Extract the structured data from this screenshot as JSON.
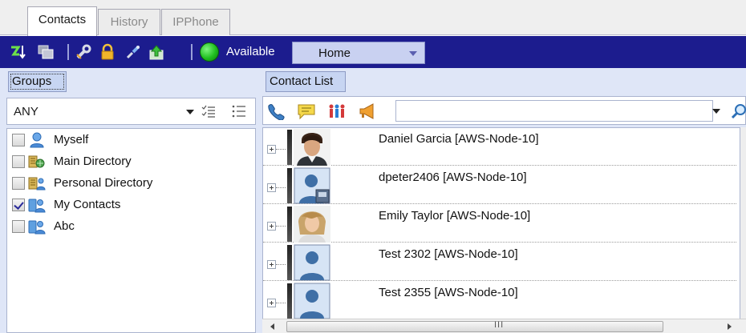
{
  "top_tabs": [
    {
      "label": "Contacts",
      "active": true
    },
    {
      "label": "History",
      "active": false
    },
    {
      "label": "IPPhone",
      "active": false
    }
  ],
  "toolbar": {
    "icons": [
      "sort-icon",
      "windows-icon",
      "wrench-icon",
      "lock-icon",
      "connect-icon",
      "upload-icon"
    ],
    "presence_status": "Available",
    "presence_color": "#22c022",
    "location": "Home"
  },
  "groups_panel": {
    "tab_label": "Groups",
    "filter_value": "ANY",
    "items": [
      {
        "label": "Myself",
        "checked": false,
        "icon": "person-icon"
      },
      {
        "label": "Main Directory",
        "checked": false,
        "icon": "directory-icon"
      },
      {
        "label": "Personal Directory",
        "checked": false,
        "icon": "personal-directory-icon"
      },
      {
        "label": "My Contacts",
        "checked": true,
        "icon": "contacts-icon"
      },
      {
        "label": "Abc",
        "checked": false,
        "icon": "group-icon"
      }
    ]
  },
  "contact_panel": {
    "tab_label": "Contact List",
    "toolbar_icons": [
      "phone-icon",
      "chat-icon",
      "people-icon",
      "megaphone-icon"
    ],
    "search_value": "",
    "contacts": [
      {
        "name": "Daniel Garcia [AWS-Node-10]",
        "avatar": "photo-man"
      },
      {
        "name": "dpeter2406 [AWS-Node-10]",
        "avatar": "placeholder-phone"
      },
      {
        "name": "Emily Taylor [AWS-Node-10]",
        "avatar": "photo-woman"
      },
      {
        "name": "Test 2302 [AWS-Node-10]",
        "avatar": "placeholder"
      },
      {
        "name": "Test 2355 [AWS-Node-10]",
        "avatar": "placeholder"
      }
    ],
    "scroll_grip": "III"
  },
  "colors": {
    "toolbar_bg": "#1c1c8e",
    "panel_bg": "#dfe6f7",
    "tab_bg": "#c7d5f2"
  }
}
